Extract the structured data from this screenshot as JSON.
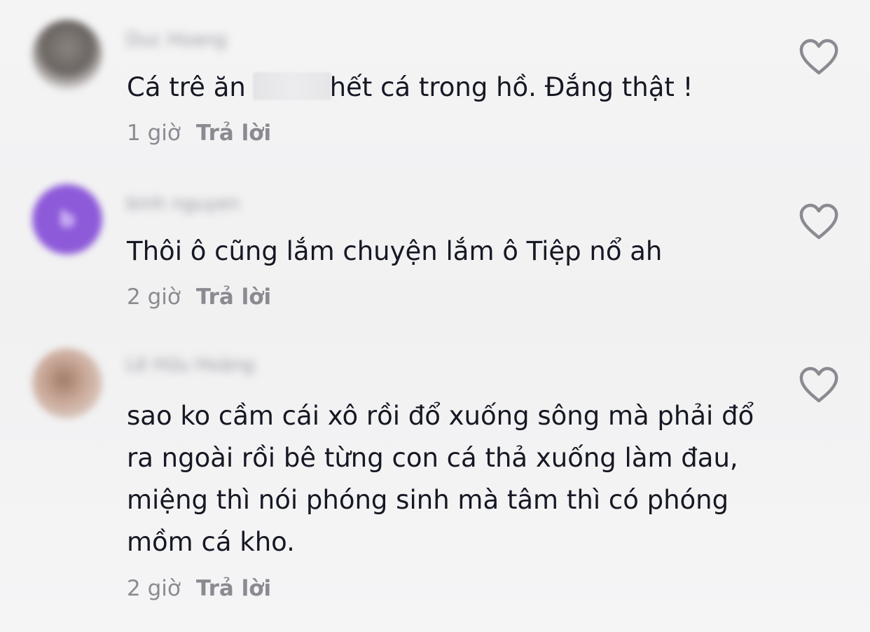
{
  "comments": [
    {
      "username": "Duc Hoang",
      "avatar_letter": "",
      "text_before": "Cá trê ăn",
      "text_redacted": "",
      "text_after": "hết cá trong hồ. Đắng thật !",
      "time": "1 giờ",
      "reply_label": "Trả lời",
      "like_icon": "heart-outline-icon"
    },
    {
      "username": "binh nguyen",
      "avatar_letter": "b",
      "text": "Thôi ô cũng lắm chuyện lắm ô Tiệp nổ ah",
      "time": "2 giờ",
      "reply_label": "Trả lời",
      "like_icon": "heart-outline-icon"
    },
    {
      "username": "Lê Hữu Hoàng",
      "avatar_letter": "",
      "text": "sao ko cầm cái xô rồi đổ xuống sông mà phải đổ ra ngoài rồi bê từng con cá thả xuống làm đau, miệng thì nói phóng sinh mà tâm thì có phóng mồm cá kho.",
      "time": "2 giờ",
      "reply_label": "Trả lời",
      "like_icon": "heart-outline-icon"
    }
  ],
  "colors": {
    "background": "#f2f2f3",
    "text": "#161823",
    "meta": "#8a8b91",
    "avatar_purple": "#8d5ad9"
  }
}
